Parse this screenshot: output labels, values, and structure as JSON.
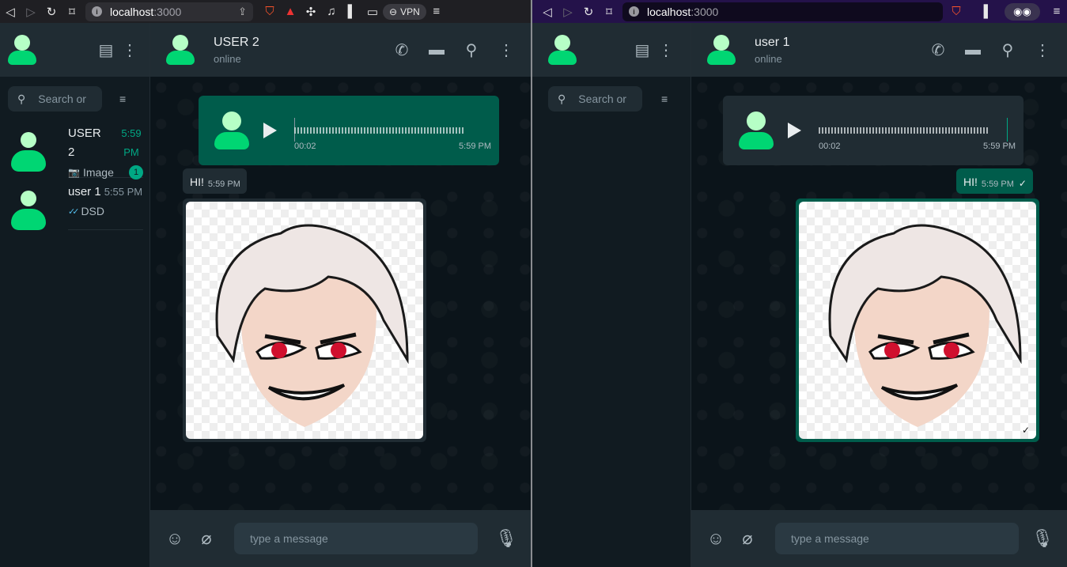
{
  "left": {
    "browser": {
      "host": "localhost",
      "port": ":3000",
      "vpn_label": "VPN"
    },
    "search_placeholder": "Search or",
    "chats": [
      {
        "name": "USER 2",
        "time": "5:59 PM",
        "preview": "Image",
        "unread": "1"
      },
      {
        "name": "user 1",
        "time": "5:55 PM",
        "preview": "DSD"
      }
    ],
    "chat_header": {
      "name": "USER 2",
      "status": "online"
    },
    "messages": {
      "audio": {
        "duration": "00:02",
        "time": "5:59 PM"
      },
      "text": {
        "text": "HI!",
        "time": "5:59 PM"
      }
    },
    "composer_placeholder": "type a message"
  },
  "right": {
    "browser": {
      "host": "localhost",
      "port": ":3000"
    },
    "search_placeholder": "Search or",
    "chat_header": {
      "name": "user 1",
      "status": "online"
    },
    "messages": {
      "audio": {
        "duration": "00:02",
        "time": "5:59 PM"
      },
      "text": {
        "text": "HI!",
        "time": "5:59 PM"
      }
    },
    "composer_placeholder": "type a message"
  },
  "colors": {
    "accent": "#00a884",
    "outgoing_bubble": "#005c4b",
    "incoming_bubble": "#202c33",
    "avatar_body": "#00d673",
    "avatar_head": "#b6ffc6"
  }
}
